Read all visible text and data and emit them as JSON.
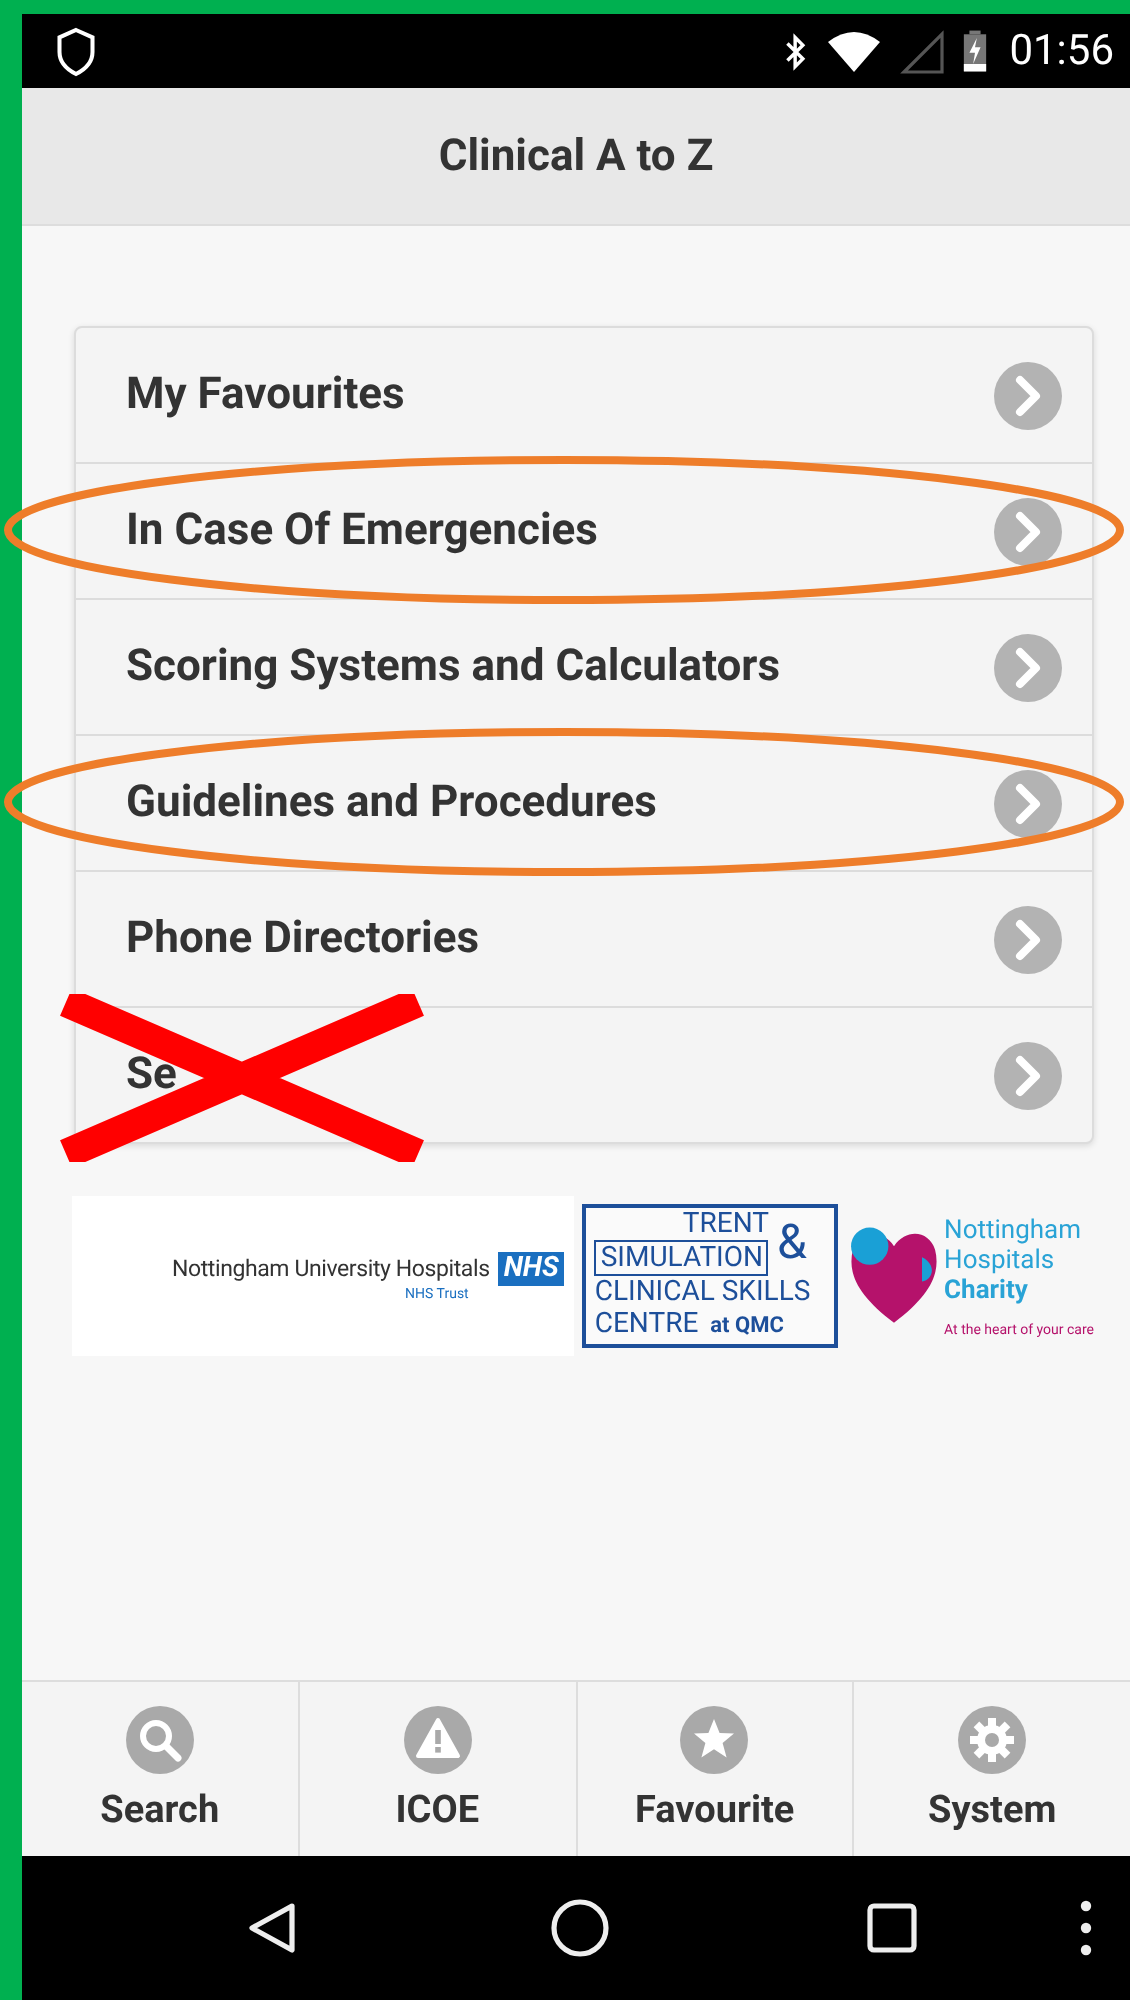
{
  "status_bar": {
    "time": "01:56"
  },
  "header": {
    "title": "Clinical A to Z"
  },
  "menu": [
    {
      "label": "My Favourites",
      "circled": false,
      "crossed": false
    },
    {
      "label": "In Case Of Emergencies",
      "circled": true,
      "crossed": false
    },
    {
      "label": "Scoring Systems and Calculators",
      "circled": false,
      "crossed": false
    },
    {
      "label": "Guidelines and Procedures",
      "circled": true,
      "crossed": false
    },
    {
      "label": "Phone Directories",
      "circled": false,
      "crossed": false
    },
    {
      "label": "Se",
      "circled": false,
      "crossed": true
    }
  ],
  "logos": {
    "nuh": {
      "name": "Nottingham University Hospitals",
      "badge": "NHS",
      "sub": "NHS Trust"
    },
    "trent": {
      "lines": [
        "TRENT",
        "SIMULATION",
        "&",
        "CLINICAL SKILLS",
        "CENTRE",
        "at QMC"
      ]
    },
    "charity": {
      "lines": [
        "Nottingham",
        "Hospitals",
        "Charity"
      ],
      "tagline": "At the heart of your care"
    }
  },
  "tabs": [
    {
      "label": "Search"
    },
    {
      "label": "ICOE"
    },
    {
      "label": "Favourite"
    },
    {
      "label": "System"
    }
  ]
}
